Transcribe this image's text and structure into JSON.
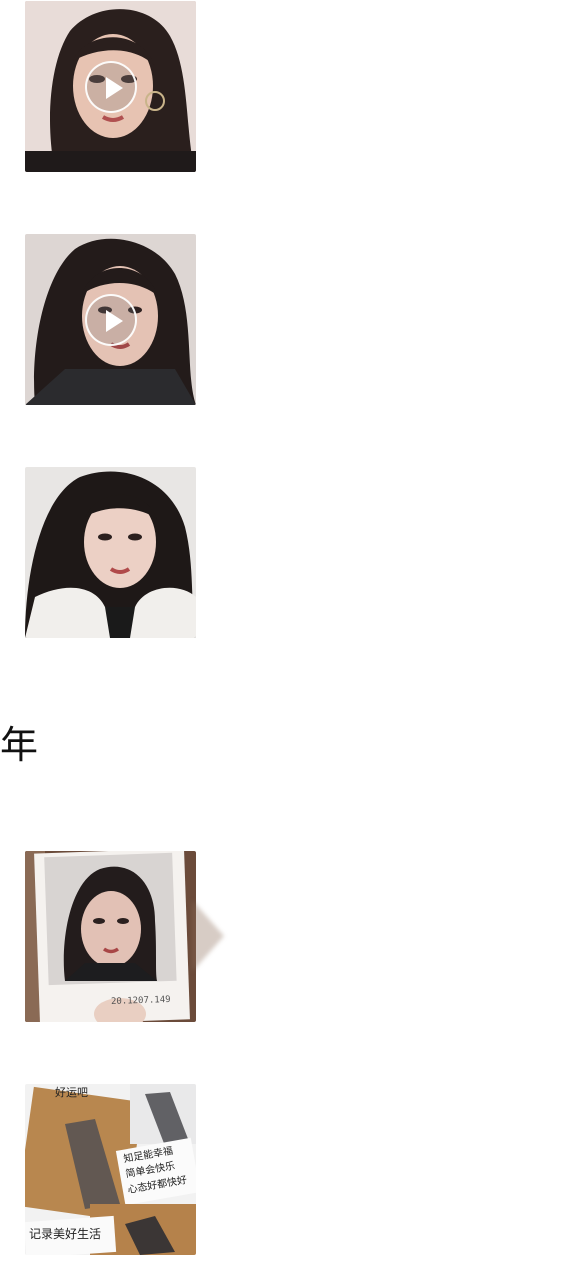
{
  "moments": [
    {
      "type": "video",
      "icon": "play-icon"
    },
    {
      "type": "video",
      "icon": "play-icon"
    },
    {
      "type": "photo"
    }
  ],
  "section_year": "年",
  "moments_year": [
    {
      "type": "photo",
      "caption": "20.1207.149"
    },
    {
      "type": "photo",
      "texts": [
        "记录美好生活",
        "知足能幸福",
        "简单会快乐",
        "心态好都快好",
        "好运吧"
      ]
    }
  ]
}
